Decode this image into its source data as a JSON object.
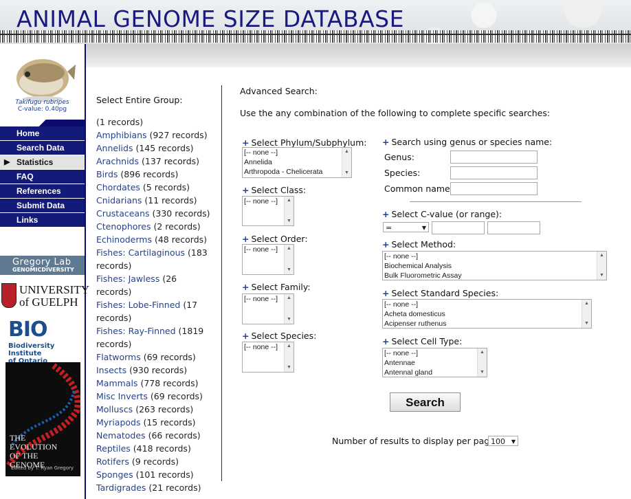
{
  "header": {
    "title": "ANIMAL GENOME SIZE DATABASE"
  },
  "sidebar": {
    "fish_species": "Takifugu rubripes",
    "fish_cvalue": "C-value: 0.40pg",
    "nav": [
      {
        "label": "Home"
      },
      {
        "label": "Search Data"
      },
      {
        "label": "Statistics",
        "active": true
      },
      {
        "label": "FAQ"
      },
      {
        "label": "References"
      },
      {
        "label": "Submit Data"
      },
      {
        "label": "Links"
      }
    ],
    "gregory_lab": "Gregory Lab",
    "gregory_sub": "GENOMICDIVERSITY",
    "guelph_1": "UNIVERSITY",
    "guelph_2": "of GUELPH",
    "bio_logo": "BIO",
    "bio_sub_1": "Biodiversity Institute",
    "bio_sub_2": "of Ontario",
    "book_title_1": "THE",
    "book_title_2": "EVOLUTION",
    "book_title_3": "OF THE",
    "book_title_4": "GENOME",
    "book_author": "Edited by T. Ryan Gregory"
  },
  "groups": {
    "title": "Select Entire Group:",
    "items": [
      {
        "name": "",
        "count": "(1 records)"
      },
      {
        "name": "Amphibians",
        "count": "(927 records)"
      },
      {
        "name": "Annelids",
        "count": "(145 records)"
      },
      {
        "name": "Arachnids",
        "count": "(137 records)"
      },
      {
        "name": "Birds",
        "count": "(896 records)"
      },
      {
        "name": "Chordates",
        "count": "(5 records)"
      },
      {
        "name": "Cnidarians",
        "count": "(11 records)"
      },
      {
        "name": "Crustaceans",
        "count": "(330 records)"
      },
      {
        "name": "Ctenophores",
        "count": "(2 records)"
      },
      {
        "name": "Echinoderms",
        "count": "(48 records)"
      },
      {
        "name": "Fishes: Cartilaginous",
        "count": "(183 records)"
      },
      {
        "name": "Fishes: Jawless",
        "count": "(26 records)"
      },
      {
        "name": "Fishes: Lobe-Finned",
        "count": "(17 records)"
      },
      {
        "name": "Fishes: Ray-Finned",
        "count": "(1819 records)"
      },
      {
        "name": "Flatworms",
        "count": "(69 records)"
      },
      {
        "name": "Insects",
        "count": "(930 records)"
      },
      {
        "name": "Mammals",
        "count": "(778 records)"
      },
      {
        "name": "Misc Inverts",
        "count": "(69 records)"
      },
      {
        "name": "Molluscs",
        "count": "(263 records)"
      },
      {
        "name": "Myriapods",
        "count": "(15 records)"
      },
      {
        "name": "Nematodes",
        "count": "(66 records)"
      },
      {
        "name": "Reptiles",
        "count": "(418 records)"
      },
      {
        "name": "Rotifers",
        "count": "(9 records)"
      },
      {
        "name": "Sponges",
        "count": "(101 records)"
      },
      {
        "name": "Tardigrades",
        "count": "(21 records)"
      }
    ]
  },
  "advanced": {
    "title": "Advanced Search:",
    "intro": "Use the any combination of the following to complete specific searches:",
    "phylum": {
      "label": "Select Phylum/Subphylum:",
      "options": [
        "[-- none --]",
        "Annelida",
        "Arthropoda - Chelicerata"
      ]
    },
    "class": {
      "label": "Select Class:",
      "options": [
        "[-- none --]"
      ]
    },
    "order": {
      "label": "Select Order:",
      "options": [
        "[-- none --]"
      ]
    },
    "family": {
      "label": "Select Family:",
      "options": [
        "[-- none --]"
      ]
    },
    "species": {
      "label": "Select Species:",
      "options": [
        "[-- none --]"
      ]
    },
    "name_search": {
      "label": "Search using genus or species name:",
      "genus": "Genus:",
      "species": "Species:",
      "common": "Common name:"
    },
    "cvalue": {
      "label": "Select C-value (or range):",
      "operator": "="
    },
    "method": {
      "label": "Select Method:",
      "options": [
        "[-- none --]",
        "Biochemical Analysis",
        "Bulk Fluorometric Assay"
      ]
    },
    "standard": {
      "label": "Select Standard Species:",
      "options": [
        "[-- none --]",
        "Acheta domesticus",
        "Acipenser ruthenus"
      ]
    },
    "celltype": {
      "label": "Select Cell Type:",
      "options": [
        "[-- none --]",
        "Antennae",
        "Antennal gland"
      ]
    },
    "search_button": "Search",
    "results_label": "Number of results to display per page:",
    "results_value": "100"
  },
  "icon_names": [
    "triangle-right-icon",
    "plus-icon",
    "chevron-down-icon",
    "scroll-up-icon",
    "scroll-down-icon"
  ],
  "colors": {
    "nav_bg": "#141a78",
    "title_blue": "#1a1a7e",
    "link_blue": "#23438c",
    "plus_blue": "#1b3fa0"
  }
}
